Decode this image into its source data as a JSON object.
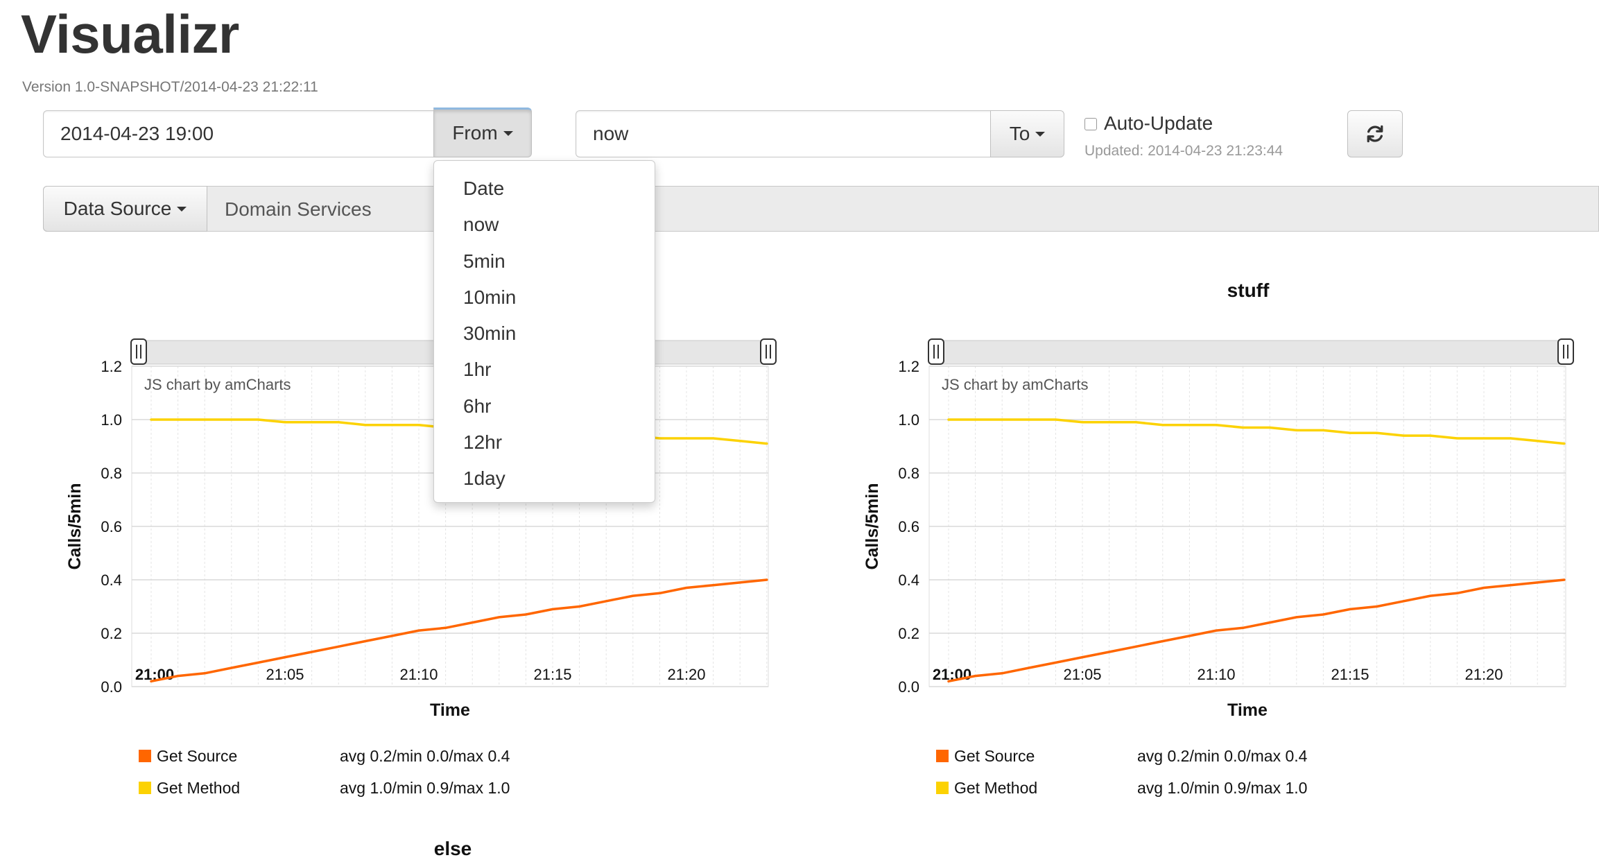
{
  "app": {
    "title": "Visualizr",
    "version": "Version 1.0-SNAPSHOT/2014-04-23 21:22:11"
  },
  "time_range": {
    "from_value": "2014-04-23 19:00",
    "from_label": "From",
    "to_value": "now",
    "to_label": "To",
    "auto_update_label": "Auto-Update",
    "auto_update_checked": false,
    "updated_text": "Updated: 2014-04-23 21:23:44",
    "refresh_icon": "refresh-icon"
  },
  "datasource": {
    "button_label": "Data Source",
    "selected": "Domain Services"
  },
  "dropdown": {
    "items": [
      "Date",
      "now",
      "5min",
      "10min",
      "30min",
      "1hr",
      "6hr",
      "12hr",
      "1day"
    ]
  },
  "charts_common": {
    "credit": "JS chart by amCharts",
    "ylabel": "Calls/5min",
    "xlabel": "Time",
    "x_ticks": [
      "21:00",
      "21:05",
      "21:10",
      "21:15",
      "21:20"
    ],
    "y_ticks": [
      "0.0",
      "0.2",
      "0.4",
      "0.6",
      "0.8",
      "1.0",
      "1.2"
    ],
    "colors": {
      "get_source": "#ff6600",
      "get_method": "#fcd202"
    }
  },
  "chart_data": [
    {
      "type": "line",
      "title": "",
      "xlabel": "Time",
      "ylabel": "Calls/5min",
      "ylim": [
        0,
        1.2
      ],
      "x": [
        "21:00",
        "21:01",
        "21:02",
        "21:03",
        "21:04",
        "21:05",
        "21:06",
        "21:07",
        "21:08",
        "21:09",
        "21:10",
        "21:11",
        "21:12",
        "21:13",
        "21:14",
        "21:15",
        "21:16",
        "21:17",
        "21:18",
        "21:19",
        "21:20",
        "21:21",
        "21:22",
        "21:23"
      ],
      "series": [
        {
          "name": "Get Source",
          "color": "#ff6600",
          "stats": "avg 0.2/min 0.0/max 0.4",
          "values": [
            0.02,
            0.04,
            0.05,
            0.07,
            0.09,
            0.11,
            0.13,
            0.15,
            0.17,
            0.19,
            0.21,
            0.22,
            0.24,
            0.26,
            0.27,
            0.29,
            0.3,
            0.32,
            0.34,
            0.35,
            0.37,
            0.38,
            0.39,
            0.4
          ]
        },
        {
          "name": "Get Method",
          "color": "#fcd202",
          "stats": "avg 1.0/min 0.9/max 1.0",
          "values": [
            1.0,
            1.0,
            1.0,
            1.0,
            1.0,
            0.99,
            0.99,
            0.99,
            0.98,
            0.98,
            0.98,
            0.97,
            0.97,
            0.96,
            0.96,
            0.95,
            0.95,
            0.94,
            0.94,
            0.93,
            0.93,
            0.93,
            0.92,
            0.91
          ]
        }
      ]
    },
    {
      "type": "line",
      "title": "stuff",
      "xlabel": "Time",
      "ylabel": "Calls/5min",
      "ylim": [
        0,
        1.2
      ],
      "x": [
        "21:00",
        "21:01",
        "21:02",
        "21:03",
        "21:04",
        "21:05",
        "21:06",
        "21:07",
        "21:08",
        "21:09",
        "21:10",
        "21:11",
        "21:12",
        "21:13",
        "21:14",
        "21:15",
        "21:16",
        "21:17",
        "21:18",
        "21:19",
        "21:20",
        "21:21",
        "21:22",
        "21:23"
      ],
      "series": [
        {
          "name": "Get Source",
          "color": "#ff6600",
          "stats": "avg 0.2/min 0.0/max 0.4",
          "values": [
            0.02,
            0.04,
            0.05,
            0.07,
            0.09,
            0.11,
            0.13,
            0.15,
            0.17,
            0.19,
            0.21,
            0.22,
            0.24,
            0.26,
            0.27,
            0.29,
            0.3,
            0.32,
            0.34,
            0.35,
            0.37,
            0.38,
            0.39,
            0.4
          ]
        },
        {
          "name": "Get Method",
          "color": "#fcd202",
          "stats": "avg 1.0/min 0.9/max 1.0",
          "values": [
            1.0,
            1.0,
            1.0,
            1.0,
            1.0,
            0.99,
            0.99,
            0.99,
            0.98,
            0.98,
            0.98,
            0.97,
            0.97,
            0.96,
            0.96,
            0.95,
            0.95,
            0.94,
            0.94,
            0.93,
            0.93,
            0.93,
            0.92,
            0.91
          ]
        }
      ]
    }
  ],
  "next_chart_title": "else"
}
